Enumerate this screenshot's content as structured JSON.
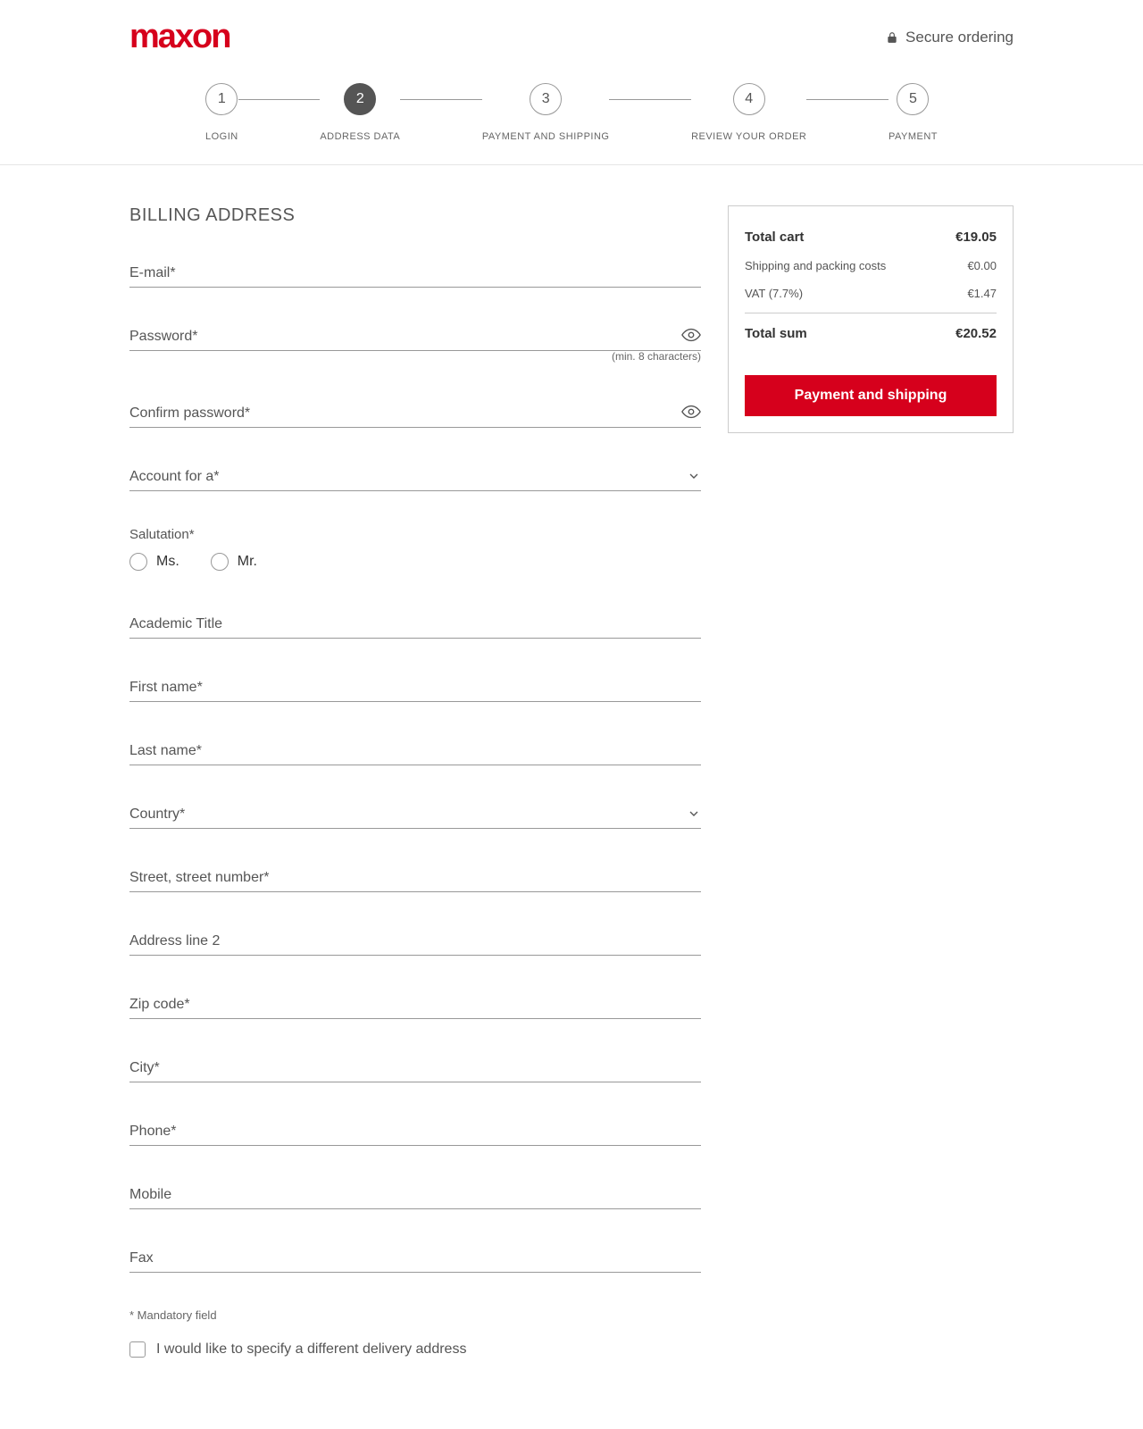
{
  "header": {
    "logo": "maxon",
    "secure": "Secure ordering"
  },
  "steps": [
    {
      "num": "1",
      "label": "LOGIN",
      "active": false
    },
    {
      "num": "2",
      "label": "ADDRESS DATA",
      "active": true
    },
    {
      "num": "3",
      "label": "PAYMENT AND SHIPPING",
      "active": false
    },
    {
      "num": "4",
      "label": "REVIEW YOUR ORDER",
      "active": false
    },
    {
      "num": "5",
      "label": "PAYMENT",
      "active": false
    }
  ],
  "form": {
    "title": "BILLING ADDRESS",
    "email": "E-mail*",
    "password": "Password*",
    "password_hint": "(min. 8 characters)",
    "confirm": "Confirm password*",
    "account_for": "Account for a*",
    "salutation_label": "Salutation*",
    "ms": "Ms.",
    "mr": "Mr.",
    "academic": "Academic Title",
    "first_name": "First name*",
    "last_name": "Last name*",
    "country": "Country*",
    "street": "Street, street number*",
    "addr2": "Address line 2",
    "zip": "Zip code*",
    "city": "City*",
    "phone": "Phone*",
    "mobile": "Mobile",
    "fax": "Fax",
    "mandatory": "* Mandatory field",
    "diff_delivery": "I would like to specify a different delivery address"
  },
  "summary": {
    "total_cart_label": "Total cart",
    "total_cart_value": "€19.05",
    "ship_label": "Shipping and packing costs",
    "ship_value": "€0.00",
    "vat_label": "VAT (7.7%)",
    "vat_value": "€1.47",
    "total_sum_label": "Total sum",
    "total_sum_value": "€20.52",
    "button": "Payment and shipping"
  }
}
